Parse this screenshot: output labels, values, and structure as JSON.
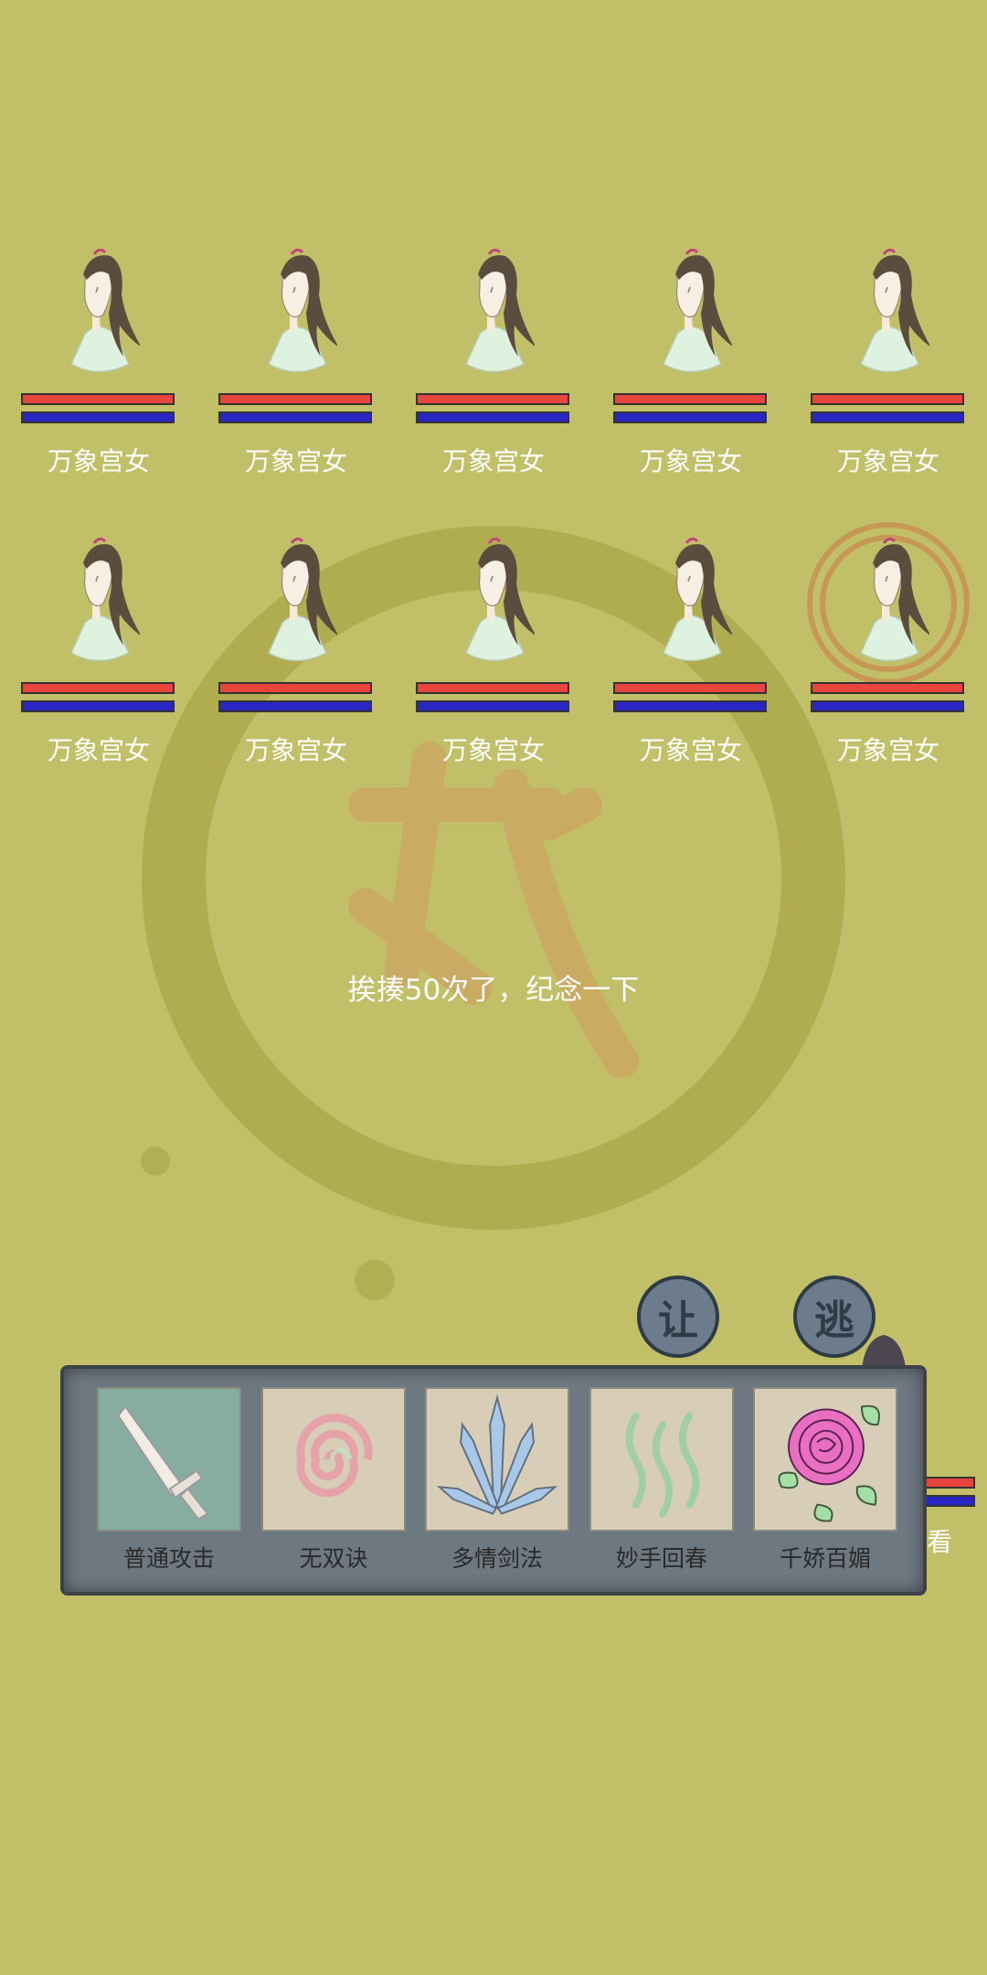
{
  "enemies": [
    {
      "name": "万象宫女",
      "hp": 1.0,
      "mp": 1.0
    },
    {
      "name": "万象宫女",
      "hp": 1.0,
      "mp": 1.0
    },
    {
      "name": "万象宫女",
      "hp": 1.0,
      "mp": 1.0
    },
    {
      "name": "万象宫女",
      "hp": 1.0,
      "mp": 1.0
    },
    {
      "name": "万象宫女",
      "hp": 1.0,
      "mp": 1.0
    },
    {
      "name": "万象宫女",
      "hp": 1.0,
      "mp": 1.0
    },
    {
      "name": "万象宫女",
      "hp": 1.0,
      "mp": 1.0
    },
    {
      "name": "万象宫女",
      "hp": 1.0,
      "mp": 1.0
    },
    {
      "name": "万象宫女",
      "hp": 1.0,
      "mp": 1.0
    },
    {
      "name": "万象宫女",
      "hp": 1.0,
      "mp": 1.0
    }
  ],
  "message": "挨揍50次了，纪念一下",
  "buttons": {
    "yield_label": "让",
    "flee_label": "逃"
  },
  "player": {
    "name_partial": "看"
  },
  "skills": [
    {
      "name": "普通攻击",
      "icon": "sword-icon"
    },
    {
      "name": "无双诀",
      "icon": "spiral-icon"
    },
    {
      "name": "多情剑法",
      "icon": "blades-icon"
    },
    {
      "name": "妙手回春",
      "icon": "healing-waves-icon"
    },
    {
      "name": "千娇百媚",
      "icon": "rose-icon"
    }
  ],
  "colors": {
    "background": "#c1bf68",
    "hp": "#e8453c",
    "mp": "#2a26c4",
    "panel": "#6e7880"
  }
}
